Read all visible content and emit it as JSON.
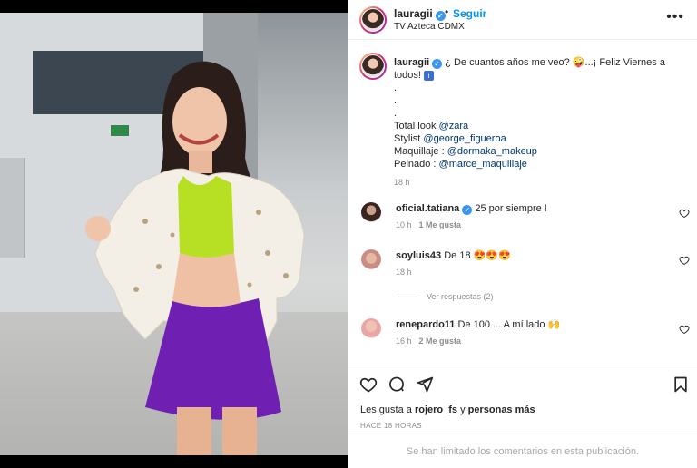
{
  "post": {
    "username": "lauragii",
    "follow_label": "Seguir",
    "location": "TV Azteca CDMX",
    "more_label": "•••"
  },
  "caption": {
    "username": "lauragii",
    "text": "¿ De cuantos años me veo? 🤪...¡ Feliz Viernes a todos!",
    "badge": "i",
    "dots": [
      ".",
      ".",
      "."
    ],
    "credits": [
      {
        "label": "Total look ",
        "mention": "@zara"
      },
      {
        "label": "Stylist ",
        "mention": "@george_figueroa"
      },
      {
        "label": "Maquillaje : ",
        "mention": "@dormaka_makeup"
      },
      {
        "label": "Peinado : ",
        "mention": "@marce_maquillaje"
      }
    ],
    "time": "18 h"
  },
  "comments": [
    {
      "username": "oficial.tatiana",
      "verified": true,
      "text": "25 por siempre !",
      "time": "10 h",
      "likes": "1 Me gusta"
    },
    {
      "username": "soyluis43",
      "verified": false,
      "text": "De 18 😍😍😍",
      "time": "18 h",
      "likes": ""
    },
    {
      "username": "renepardo11",
      "verified": false,
      "text": "De 100 ... A mí lado 🙌",
      "time": "16 h",
      "likes": "2 Me gusta"
    }
  ],
  "view_replies": "Ver respuestas (2)",
  "likes_line": {
    "prefix": "Les gusta a ",
    "user": "rojero_fs",
    "middle": " y ",
    "others": "personas más"
  },
  "posted_time": "HACE 18 HORAS",
  "comments_limited": "Se han limitado los comentarios en esta publicación.",
  "icons": {
    "verified": "verified-badge-icon",
    "like": "heart-icon",
    "comment": "comment-bubble-icon",
    "share": "paper-plane-icon",
    "save": "bookmark-icon",
    "more": "more-options-icon"
  },
  "colors": {
    "follow": "#0095f6",
    "mention": "#00376b",
    "verified": "#3897f0",
    "muted": "#8e8e8e"
  }
}
